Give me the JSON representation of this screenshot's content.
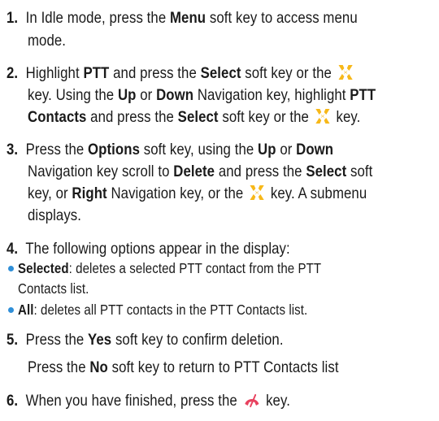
{
  "step1": {
    "num": "1.",
    "t1": "In Idle mode, press the ",
    "b1": "Menu",
    "t2": " soft key to access menu",
    "t3": "mode."
  },
  "step2": {
    "num": "2.",
    "t1": "Highlight ",
    "b1": "PTT",
    "t2": " and press the ",
    "b2": "Select",
    "t3": " soft key or the",
    "t4": "key. Using the ",
    "b3": "Up",
    "t5": " or ",
    "b4": "Down",
    "t6": " Navigation key, highlight ",
    "b5": "PTT",
    "b6": "Contacts",
    "t7": " and press the ",
    "b7": "Select",
    "t8": " soft key or the ",
    "t9": " key."
  },
  "step3": {
    "num": "3.",
    "t1": "Press the ",
    "b1": "Options",
    "t2": " soft key, using the ",
    "b2": "Up",
    "t3": " or ",
    "b3": "Down",
    "t4": "Navigation key scroll to ",
    "b4": "Delete",
    "t5": " and press the ",
    "b5": "Select",
    "t6": " soft",
    "t7": "key, or ",
    "b6": "Right",
    "t8": " Navigation key, or the ",
    "t9": " key. A submenu",
    "t10": "displays."
  },
  "step4": {
    "num": "4.",
    "t1": "The following options appear in the display:",
    "bullets": [
      {
        "label": "Selected",
        "text": ": deletes a selected PTT contact from the PTT",
        "cont": "Contacts list."
      },
      {
        "label": "All",
        "text": ": deletes all PTT contacts in the PTT Contacts list."
      }
    ]
  },
  "step5": {
    "num": "5.",
    "t1": "Press the ",
    "b1": "Yes",
    "t2": " soft key to confirm deletion.",
    "t3": "Press the ",
    "b2": "No",
    "t4": " soft key to return to PTT Contacts list"
  },
  "step6": {
    "num": "6.",
    "t1": "When you have finished, press the ",
    "t2": " key."
  },
  "icons": {
    "select_key": "select-key-icon",
    "end_key": "end-call-key-icon",
    "select_key_color": "#f7b819",
    "end_key_color": "#e8425f",
    "bullet_color": "#2f8fd8"
  }
}
